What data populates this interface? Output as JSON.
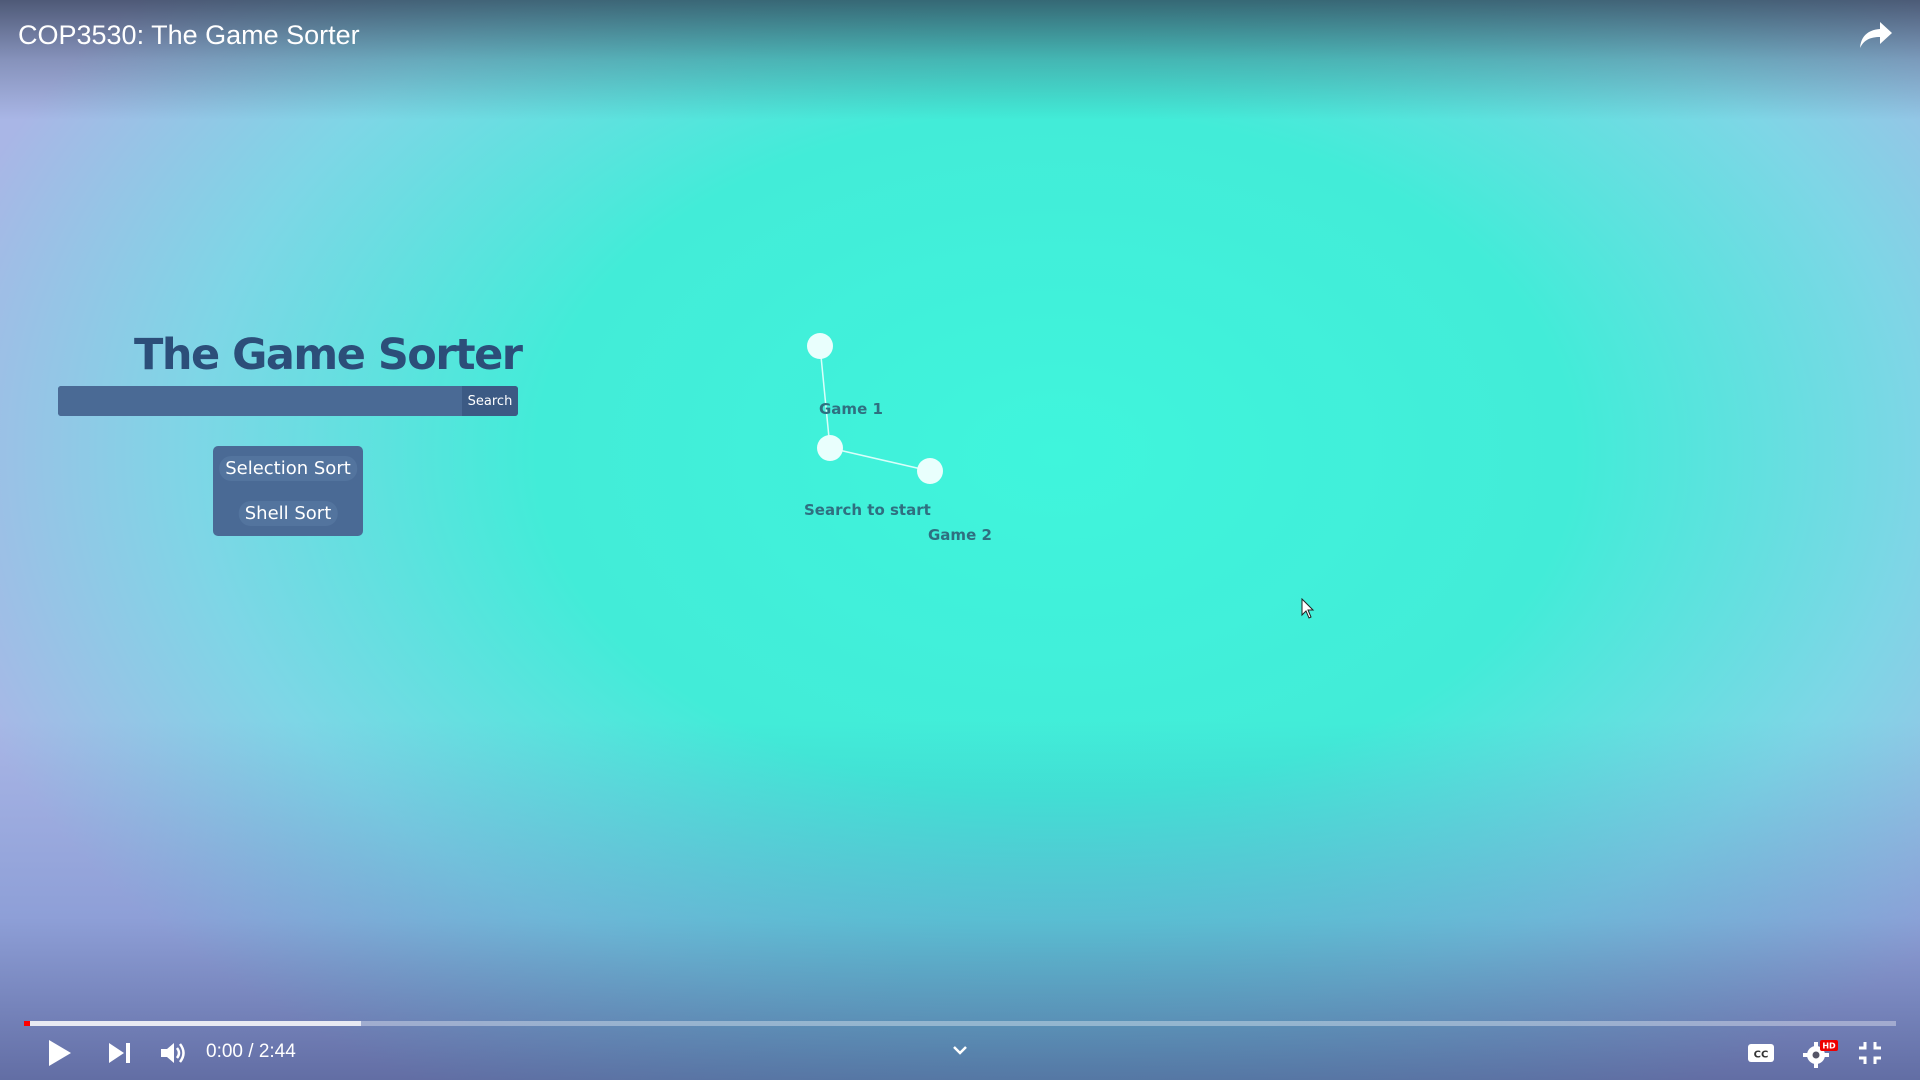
{
  "player": {
    "video_title": "COP3530: The Game Sorter",
    "time_display": "0:00 / 2:44",
    "played_fraction": 0.003,
    "buffered_fraction": 0.18,
    "progress_color": "#ff0000",
    "icons": [
      "share-icon",
      "play-icon",
      "next-icon",
      "volume-icon",
      "chevron-down-icon",
      "cc-icon",
      "settings-icon",
      "hd-badge",
      "exit-fullscreen-icon"
    ],
    "hd_badge": "HD"
  },
  "app": {
    "title": "The Game Sorter",
    "search": {
      "value": "",
      "placeholder": "",
      "button_label": "Search"
    },
    "sort_buttons": [
      "Selection Sort",
      "Shell Sort"
    ],
    "colors": {
      "accent": "#2c4e79",
      "panel": "#4a6a95"
    }
  },
  "graph": {
    "labels": {
      "game1": "Game 1",
      "start_hint": "Search to start",
      "game2": "Game 2"
    }
  }
}
